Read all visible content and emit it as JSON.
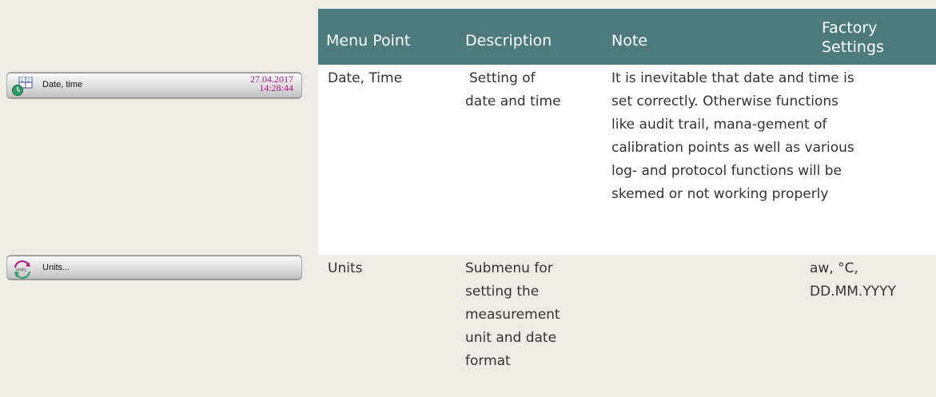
{
  "widgets": {
    "date_time": {
      "label": "Date, time",
      "date": "27.04.2017",
      "time": "14:28:44",
      "icon": "calendar-clock-icon"
    },
    "units": {
      "label": "Units...",
      "icon_text": "units",
      "icon": "units-refresh-icon"
    }
  },
  "table": {
    "headers": {
      "menu_point": "Menu Point",
      "description": "Description",
      "note": "Note",
      "factory_line1": "Factory",
      "factory_line2": "Settings"
    },
    "rows": [
      {
        "menu_point": "Date, Time",
        "description_lines": [
          "Setting of",
          "date and time"
        ],
        "note_lines": [
          "It is inevitable that date and time is",
          "set correctly. Otherwise  functions",
          "like audit trail, mana-gement of",
          "calibration points as well as various",
          "log- and protocol functions will be",
          "skemed or not working properly"
        ],
        "factory_lines": []
      },
      {
        "menu_point": "Units",
        "description_lines": [
          "Submenu for",
          "setting the",
          "measurement",
          "unit and date",
          "format"
        ],
        "note_lines": [],
        "factory_lines": [
          "aw, °C,",
          "DD.MM.YYYY"
        ]
      }
    ]
  },
  "colors": {
    "header_bg": "#4d7b7d",
    "page_bg": "#efece7",
    "date_accent": "#b0177f"
  }
}
